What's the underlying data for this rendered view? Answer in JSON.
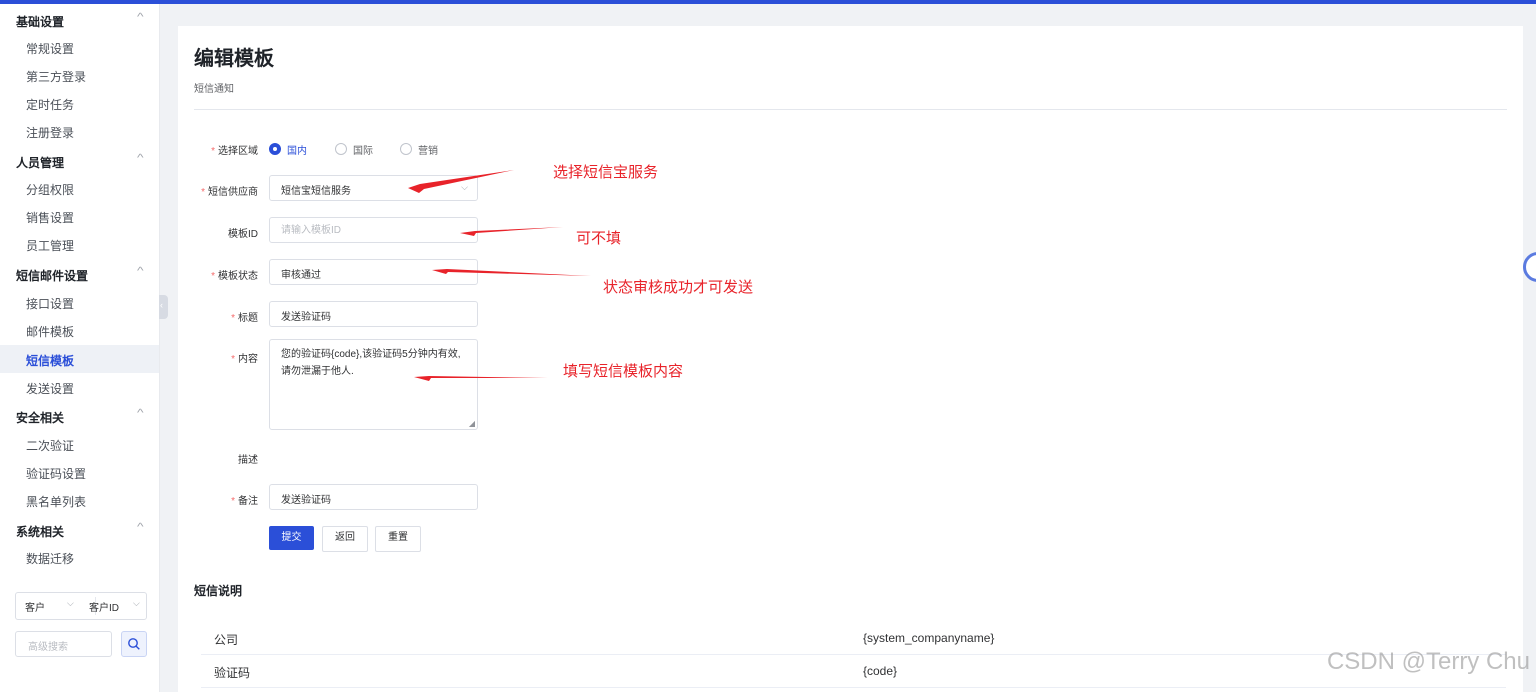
{
  "sidebar": {
    "groups": [
      {
        "title": "基础设置",
        "items": [
          "常规设置",
          "第三方登录",
          "定时任务",
          "注册登录"
        ]
      },
      {
        "title": "人员管理",
        "items": [
          "分组权限",
          "销售设置",
          "员工管理"
        ]
      },
      {
        "title": "短信邮件设置",
        "items": [
          "接口设置",
          "邮件模板",
          "短信模板",
          "发送设置"
        ]
      },
      {
        "title": "安全相关",
        "items": [
          "二次验证",
          "验证码设置",
          "黑名单列表"
        ]
      },
      {
        "title": "系统相关",
        "items": [
          "数据迁移"
        ]
      }
    ],
    "collapse_glyph": "‹",
    "filter": {
      "left": "客户",
      "right": "客户ID"
    },
    "adv_search_placeholder": "高级搜索"
  },
  "page": {
    "title": "编辑模板",
    "subtitle": "短信通知"
  },
  "form": {
    "region": {
      "label": "选择区域",
      "options": [
        "国内",
        "国际",
        "营销"
      ],
      "selected": "国内"
    },
    "provider": {
      "label": "短信供应商",
      "value": "短信宝短信服务"
    },
    "template_id": {
      "label": "模板ID",
      "placeholder": "请输入模板ID"
    },
    "status": {
      "label": "模板状态",
      "value": "审核通过"
    },
    "title": {
      "label": "标题",
      "value": "发送验证码"
    },
    "content": {
      "label": "内容",
      "value": "您的验证码{code},该验证码5分钟内有效,请勿泄漏于他人."
    },
    "description": {
      "label": "描述"
    },
    "remark": {
      "label": "备注",
      "value": "发送验证码"
    },
    "required_mark": "*",
    "buttons": {
      "submit": "提交",
      "back": "返回",
      "reset": "重置"
    }
  },
  "sms_notes": {
    "title": "短信说明",
    "rows": [
      {
        "key": "公司",
        "value": "{system_companyname}"
      },
      {
        "key": "验证码",
        "value": "{code}"
      }
    ]
  },
  "annotations": [
    "选择短信宝服务",
    "可不填",
    "状态审核成功才可发送",
    "填写短信模板内容"
  ],
  "watermark": "CSDN @Terry Chu",
  "colors": {
    "accent": "#2b4fd8",
    "annotation": "#e8232a",
    "required": "#f56c6c"
  }
}
